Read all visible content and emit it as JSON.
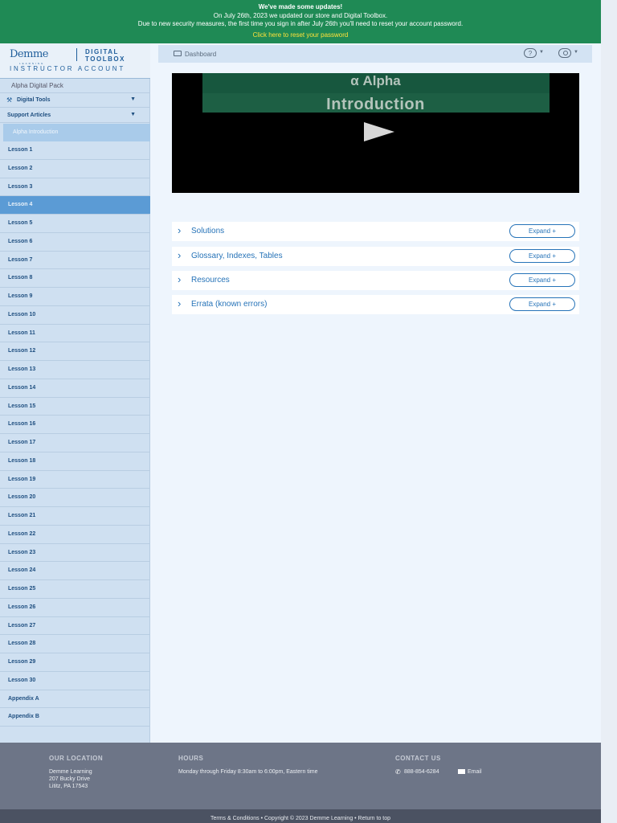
{
  "banner": {
    "headline": "We've made some updates!",
    "line1": "On July 26th, 2023 we updated our store and Digital Toolbox.",
    "line2": "Due to new security measures, the first time you sign in after July 26th you'll need to reset your account password.",
    "link": "Click here to reset your password"
  },
  "brand": {
    "logo": "Demme",
    "logo_sub": "LEARNING",
    "digital": "DIGITAL",
    "toolbox": "TOOLBOX",
    "account": "INSTRUCTOR ACCOUNT"
  },
  "sidebar": {
    "pack": "Alpha Digital Pack",
    "digital_tools": "Digital Tools",
    "support_articles": "Support Articles",
    "intro": "Alpha Introduction",
    "lessons": [
      "Lesson 1",
      "Lesson 2",
      "Lesson 3",
      "Lesson 4",
      "Lesson 5",
      "Lesson 6",
      "Lesson 7",
      "Lesson 8",
      "Lesson 9",
      "Lesson 10",
      "Lesson 11",
      "Lesson 12",
      "Lesson 13",
      "Lesson 14",
      "Lesson 15",
      "Lesson 16",
      "Lesson 17",
      "Lesson 18",
      "Lesson 19",
      "Lesson 20",
      "Lesson 21",
      "Lesson 22",
      "Lesson 23",
      "Lesson 24",
      "Lesson 25",
      "Lesson 26",
      "Lesson 27",
      "Lesson 28",
      "Lesson 29",
      "Lesson 30",
      "Appendix A",
      "Appendix B"
    ],
    "active_index": 3
  },
  "topbar": {
    "dashboard": "Dashboard",
    "help": "?"
  },
  "video": {
    "alpha": "α  Alpha",
    "title": "Introduction"
  },
  "accordions": [
    {
      "title": "Solutions",
      "button": "Expand +"
    },
    {
      "title": "Glossary, Indexes, Tables",
      "button": "Expand +"
    },
    {
      "title": "Resources",
      "button": "Expand +"
    },
    {
      "title": "Errata (known errors)",
      "button": "Expand +"
    }
  ],
  "footer": {
    "location_heading": "OUR LOCATION",
    "location_name": "Demme Learning",
    "address1": "207 Bucky Drive",
    "address2": "Lititz, PA 17543",
    "hours_heading": "HOURS",
    "hours": "Monday through Friday 8:30am to 6:00pm, Eastern time",
    "contact_heading": "CONTACT US",
    "phone": "888-854-6284",
    "email": "Email",
    "bottom": "Terms & Conditions • Copyright © 2023 Demme Learning • Return to top"
  },
  "colors": {
    "banner": "#1f8a55",
    "link": "#ffe23a",
    "accent": "#2673b8",
    "active": "#5b9bd5"
  }
}
